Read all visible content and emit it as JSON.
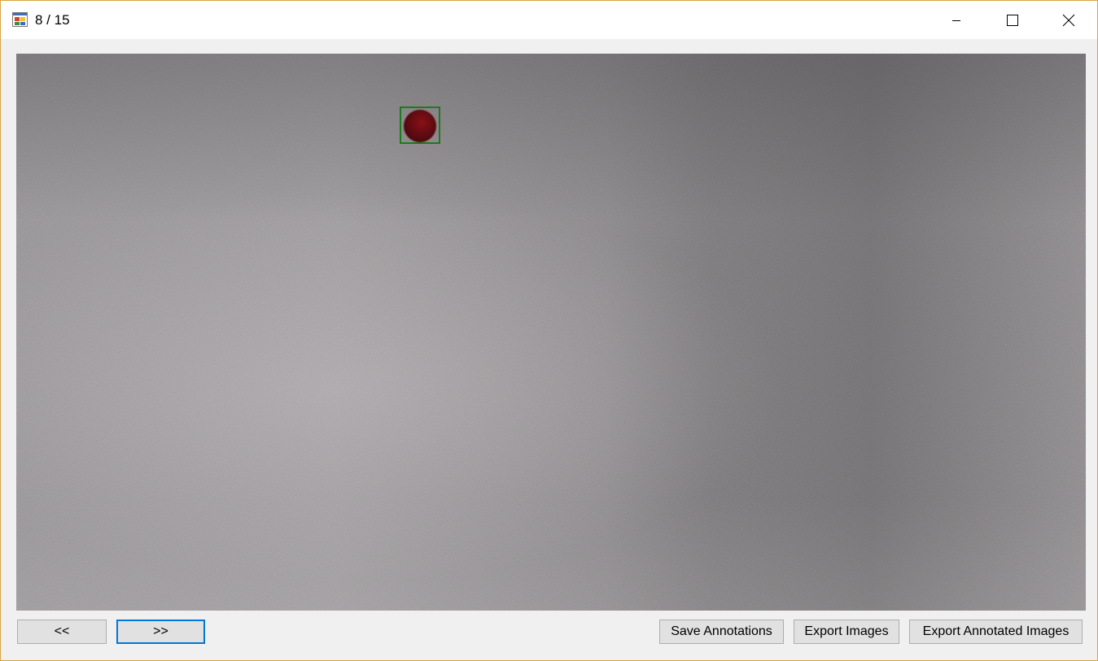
{
  "window": {
    "title": "8 / 15",
    "icons": {
      "app": "app-form-icon",
      "minimize": "minimize-icon",
      "maximize": "maximize-icon",
      "close": "close-icon"
    }
  },
  "viewer": {
    "annotation_color": "#1d7a1d",
    "object_color": "#7a0e16"
  },
  "buttons": {
    "prev_label": "<<",
    "next_label": ">>",
    "save_label": "Save Annotations",
    "export_label": "Export Images",
    "export_annotated_label": "Export Annotated Images"
  }
}
